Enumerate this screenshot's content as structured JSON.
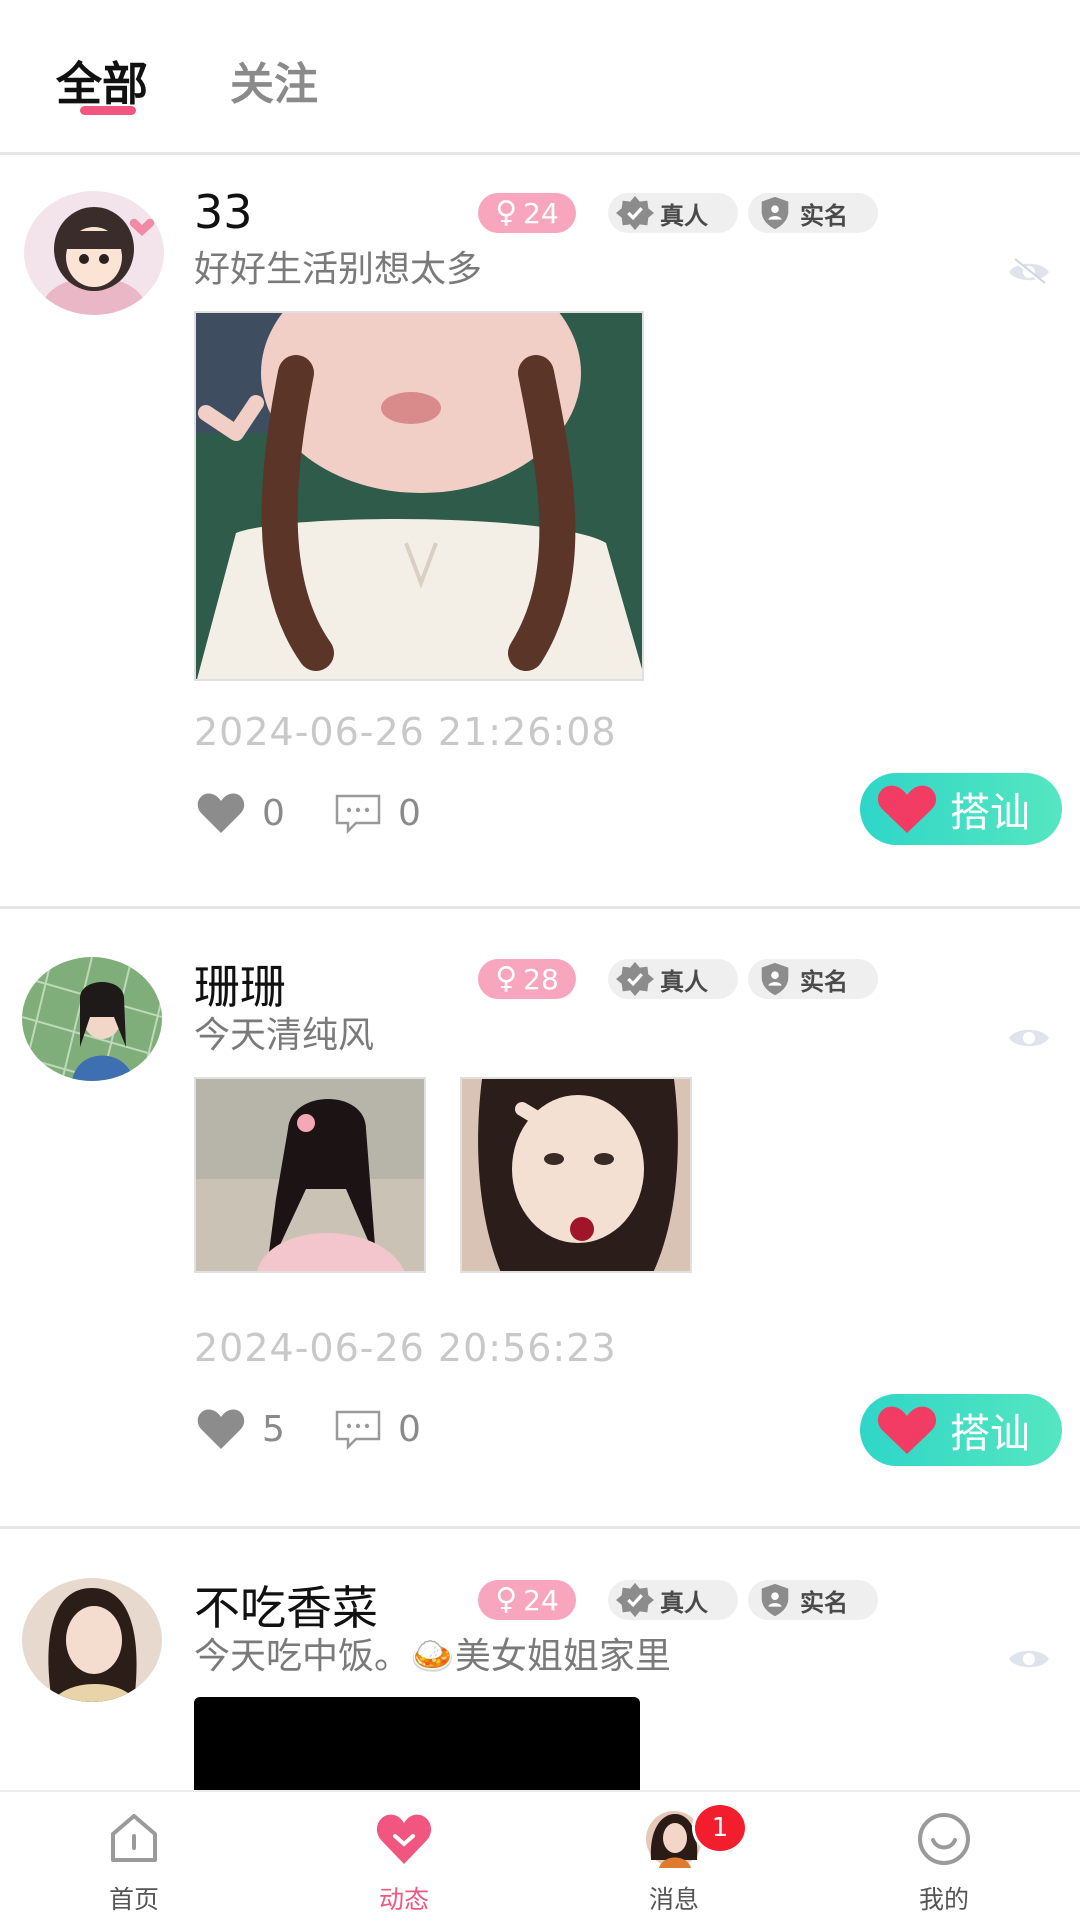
{
  "tabs": {
    "all": "全部",
    "follow": "关注"
  },
  "posts": [
    {
      "name": "33",
      "age": "24",
      "tag_real": "真人",
      "tag_verified": "实名",
      "text": "好好生活别想太多",
      "timestamp": "2024-06-26 21:26:08",
      "likes": "0",
      "comments": "0",
      "chat_label": "搭讪"
    },
    {
      "name": "珊珊",
      "age": "28",
      "tag_real": "真人",
      "tag_verified": "实名",
      "text": "今天清纯风",
      "timestamp": "2024-06-26 20:56:23",
      "likes": "5",
      "comments": "0",
      "chat_label": "搭讪"
    },
    {
      "name": "不吃香菜",
      "age": "24",
      "tag_real": "真人",
      "tag_verified": "实名",
      "text": "今天吃中饭。🍛美女姐姐家里"
    }
  ],
  "nav": {
    "home": "首页",
    "dynamic": "动态",
    "messages": "消息",
    "messages_badge": "1",
    "me": "我的"
  },
  "colors": {
    "accent": "#f0567f",
    "chat_button": "#2fd6c8",
    "badge": "#f21d2d"
  }
}
